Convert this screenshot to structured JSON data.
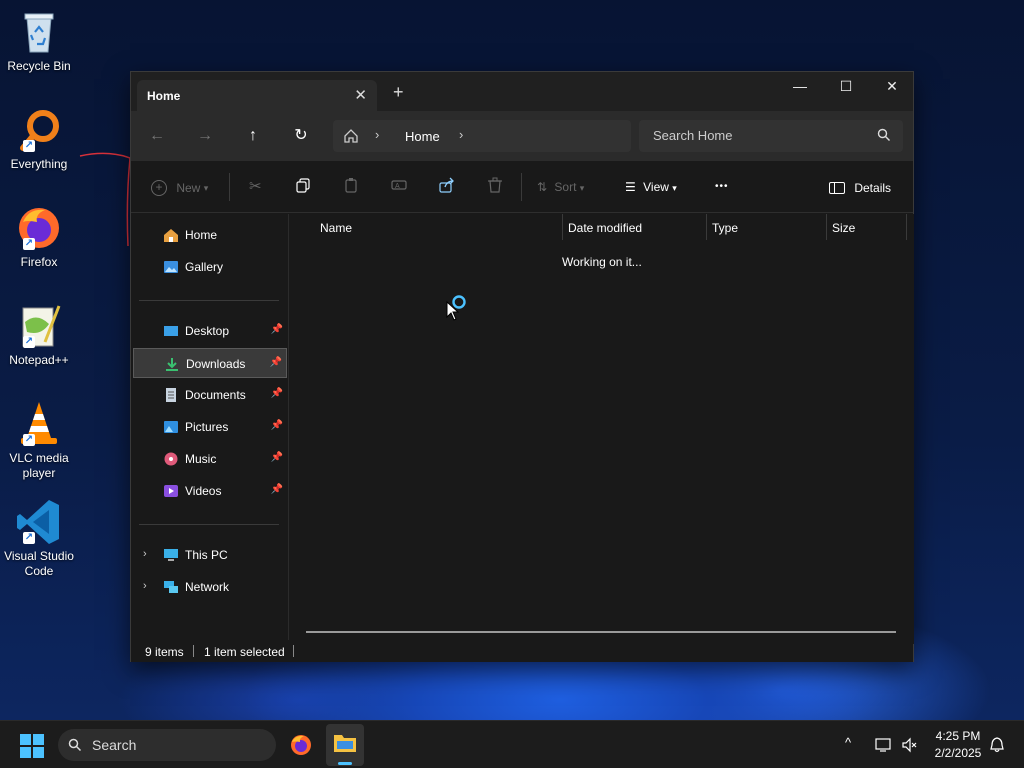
{
  "desktop": {
    "icons": [
      {
        "label": "Recycle Bin"
      },
      {
        "label": "Everything"
      },
      {
        "label": "Firefox"
      },
      {
        "label": "Notepad++"
      },
      {
        "label": "VLC media player"
      },
      {
        "label": "Visual Studio Code"
      }
    ]
  },
  "window": {
    "tab_title": "Home",
    "tab_close": "✕",
    "new_tab": "+",
    "controls": {
      "minimize": "—",
      "maximize": "☐",
      "close": "✕"
    }
  },
  "navbar": {
    "back": "←",
    "forward": "→",
    "up": "↑",
    "refresh": "↻",
    "breadcrumb": {
      "sep": "›",
      "location": "Home",
      "sep_after": "›"
    },
    "search_placeholder": "Search Home"
  },
  "toolbar": {
    "new_label": "New",
    "sort_label": "Sort",
    "view_label": "View",
    "more_label": "•••",
    "details_label": "Details"
  },
  "sidebar": {
    "home": "Home",
    "gallery": "Gallery",
    "pinned": [
      {
        "label": "Desktop"
      },
      {
        "label": "Downloads"
      },
      {
        "label": "Documents"
      },
      {
        "label": "Pictures"
      },
      {
        "label": "Music"
      },
      {
        "label": "Videos"
      }
    ],
    "this_pc": "This PC",
    "network": "Network",
    "chevron": "›",
    "pin_glyph": "📌"
  },
  "content": {
    "columns": {
      "name": "Name",
      "date_modified": "Date modified",
      "type": "Type",
      "size": "Size"
    },
    "status_message": "Working on it..."
  },
  "statusbar": {
    "items_count": "9 items",
    "selection": "1 item selected"
  },
  "taskbar": {
    "search_label": "Search",
    "time": "4:25 PM",
    "date": "2/2/2025",
    "tray_chevron": "^"
  },
  "colors": {
    "accent": "#4cc2ff",
    "window_bg": "#191919",
    "selection_bg": "#3a3a3a"
  }
}
